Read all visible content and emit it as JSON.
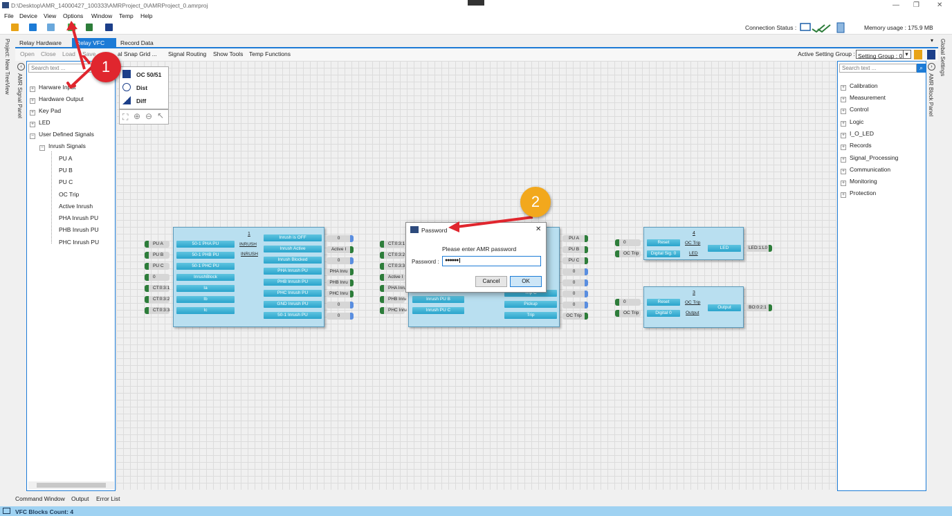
{
  "window": {
    "title": "D:\\Desktop\\AMR_14000427_100333\\AMRProject_0\\AMRProject_0.amrproj",
    "minimize": "—",
    "restore": "❐",
    "close": "✕"
  },
  "menu": [
    "File",
    "Device",
    "View",
    "Options",
    "Window",
    "Temp",
    "Help"
  ],
  "toolbar": {
    "connection_status_label": "Connection Status :",
    "memory_usage": "Memory usage : 175.9 MB"
  },
  "tabs": [
    {
      "label": "Relay Hardware"
    },
    {
      "label": "Relay VFC",
      "close": "✕"
    },
    {
      "label": "Record Data"
    }
  ],
  "subtoolbar": {
    "items": [
      "Open",
      "Close",
      "Load",
      "Save",
      "al Snap Grid ...",
      "Signal Routing",
      "Show Tools",
      "Temp Functions"
    ],
    "active_setting_group_label": "Active Setting Group :",
    "setting_group_value": "Setting Group : 0"
  },
  "left_strips": {
    "project": "Project: New TreeView",
    "signal_panel": "AMR Signal Panel"
  },
  "right_strips": {
    "global": "Global Settings",
    "block_panel": "AMR Block Panel"
  },
  "signal_panel": {
    "search_placeholder": "Search text ...",
    "items": [
      {
        "label": "Harware Input",
        "exp": "+"
      },
      {
        "label": "Hardware Output",
        "exp": "+"
      },
      {
        "label": "Key Pad",
        "exp": "+"
      },
      {
        "label": "LED",
        "exp": "+"
      },
      {
        "label": "User Defined Signals",
        "exp": "−"
      },
      {
        "label": "Inrush Signals",
        "exp": "−"
      }
    ],
    "leaves": [
      "PU A",
      "PU B",
      "PU C",
      "OC Trip",
      "Active Inrush",
      "PHA Inrush PU",
      "PHB Inrush PU",
      "PHC Inrush PU"
    ]
  },
  "block_panel": {
    "search_placeholder": "Search text ...",
    "items": [
      "Calibration",
      "Measurement",
      "Control",
      "Logic",
      "I_O_LED",
      "Records",
      "Signal_Processing",
      "Communication",
      "Monitoring",
      "Protection"
    ]
  },
  "view_panel": {
    "items": [
      "OC 50/51",
      "Dist",
      "Diff"
    ]
  },
  "block1": {
    "number": "1",
    "inputs": [
      "PU A",
      "PU B",
      "PU C",
      "0",
      "CT:0:3:1",
      "CT:0:3:2",
      "CT:0:3:3"
    ],
    "pills_left": [
      "50-1 PHA PU",
      "50-1 PHB PU",
      "50-1 PHC PU",
      "InrushBlock",
      "Ia",
      "Ib",
      "Ic"
    ],
    "labels": [
      "INRUSH",
      "INRUSH"
    ],
    "pills_right": [
      "Inrush is OFF",
      "Inrush Active",
      "Inrush Blocked",
      "PHA Inrush PU",
      "PHB Inrush PU",
      "PHC Inrush PU",
      "GND Inrush PU",
      "50-1 Inrush PU"
    ],
    "outputs": [
      "0",
      "Active I",
      "0",
      "PHA Inru",
      "PHB Inru",
      "PHC Inru",
      "0",
      "0"
    ]
  },
  "block2": {
    "inputs": [
      "CT:0:3:1",
      "CT:0:3:2",
      "CT:0:3:3",
      "Active I",
      "PHA Inru",
      "PHB Inru",
      "PHC Inru"
    ],
    "pills_left": [
      "Inrush PU B",
      "Inrush PU C"
    ],
    "pills_right": [
      "Trip C",
      "Pickup",
      "Trip"
    ],
    "outputs": [
      "PU A",
      "PU B",
      "PU C",
      "0",
      "0",
      "0",
      "0",
      "OC Trip"
    ]
  },
  "block4": {
    "number": "4",
    "inputs": [
      "0",
      "OC Trip"
    ],
    "pills": [
      "Reset",
      "Digital Sig. 0"
    ],
    "labels": [
      "OC Trip",
      "LED"
    ],
    "out_pill": "LED",
    "output": "LED:1:L0"
  },
  "block3": {
    "number": "3",
    "inputs": [
      "0",
      "OC Trip"
    ],
    "pills": [
      "Reset",
      "Digital 0"
    ],
    "labels": [
      "OC Trip",
      "Output"
    ],
    "out_pill": "Output",
    "output": "BO:0:2:1"
  },
  "dialog": {
    "title": "Password",
    "close": "✕",
    "message": "Please enter AMR password",
    "password_label": "Password :",
    "password_value": "●●●●●●",
    "cancel": "Cancel",
    "ok": "OK"
  },
  "callouts": [
    "1",
    "2"
  ],
  "bottom_tabs": [
    "Command Window",
    "Output",
    "Error List"
  ],
  "status": "VFC Blocks Count: 4",
  "colors": {
    "accent": "#1c7bd6",
    "callout": "#e0262e",
    "callout2": "#f2a81d",
    "port_green": "#2d7d3a",
    "pill": "#36add3"
  }
}
